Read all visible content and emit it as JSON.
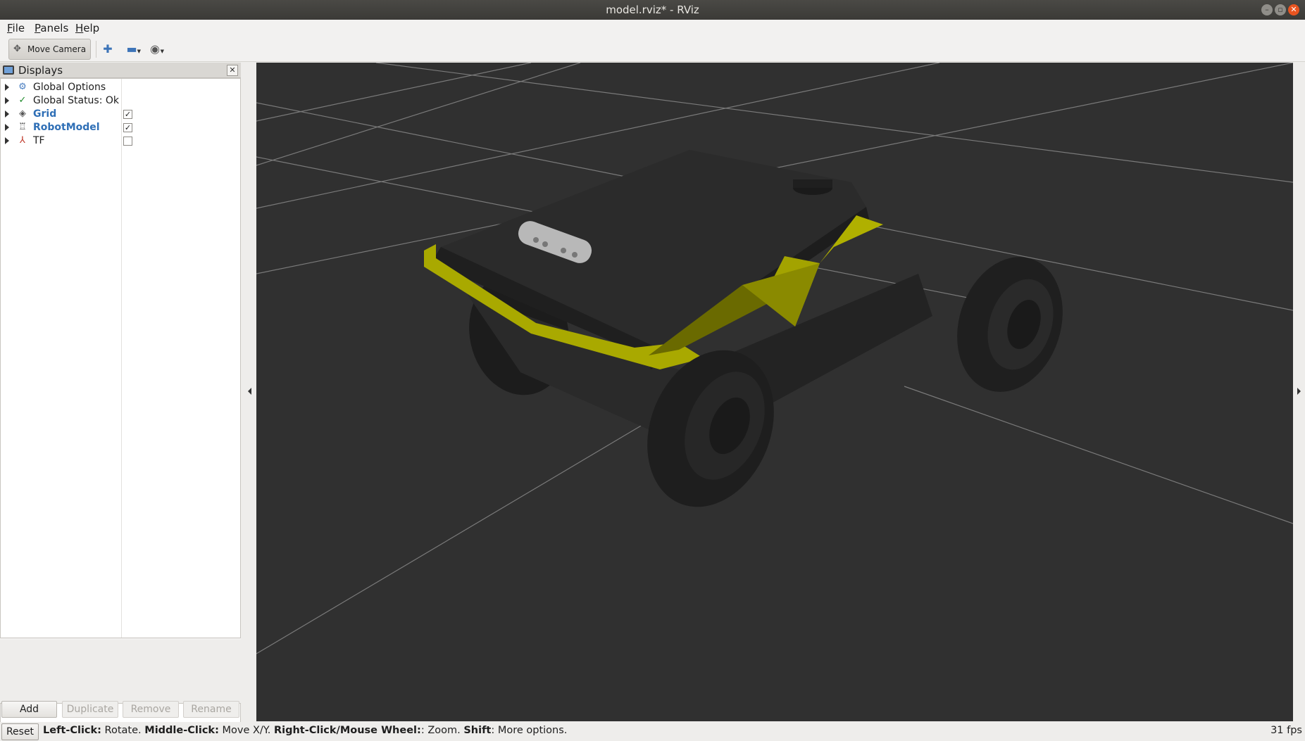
{
  "window": {
    "title": "model.rviz* - RViz",
    "controls": [
      "minimize-icon",
      "maximize-icon",
      "close-icon"
    ]
  },
  "menu": [
    {
      "accel": "F",
      "rest": "ile"
    },
    {
      "accel": "P",
      "rest": "anels"
    },
    {
      "accel": "H",
      "rest": "elp"
    }
  ],
  "toolbar": {
    "move_camera": "Move Camera",
    "tools": [
      "add-tool-icon",
      "remove-tool-icon",
      "view-options-icon"
    ]
  },
  "displays": {
    "title": "Displays",
    "items": [
      {
        "label": "Global Options",
        "icon": "gear-icon",
        "highlight": false,
        "checkbox": null
      },
      {
        "label": "Global Status: Ok",
        "icon": "check-icon",
        "highlight": false,
        "checkbox": null
      },
      {
        "label": "Grid",
        "icon": "grid-icon",
        "highlight": true,
        "checkbox": true
      },
      {
        "label": "RobotModel",
        "icon": "robot-icon",
        "highlight": true,
        "checkbox": true
      },
      {
        "label": "TF",
        "icon": "axes-icon",
        "highlight": false,
        "checkbox": false
      }
    ],
    "buttons": {
      "add": "Add",
      "duplicate": "Duplicate",
      "remove": "Remove",
      "rename": "Rename"
    }
  },
  "status": {
    "reset": "Reset",
    "segments": [
      {
        "bold": "Left-Click:",
        "text": " Rotate. "
      },
      {
        "bold": "Middle-Click:",
        "text": " Move X/Y. "
      },
      {
        "bold": "Right-Click/Mouse Wheel:",
        "text": ": Zoom. "
      },
      {
        "bold": "Shift",
        "text": ": More options."
      }
    ],
    "fps": "31 fps"
  },
  "colors": {
    "viewport_bg": "#303030",
    "bumper_yellow": "#b3b300",
    "robot_body": "#262626",
    "accent_blue": "#2f6fb6"
  }
}
